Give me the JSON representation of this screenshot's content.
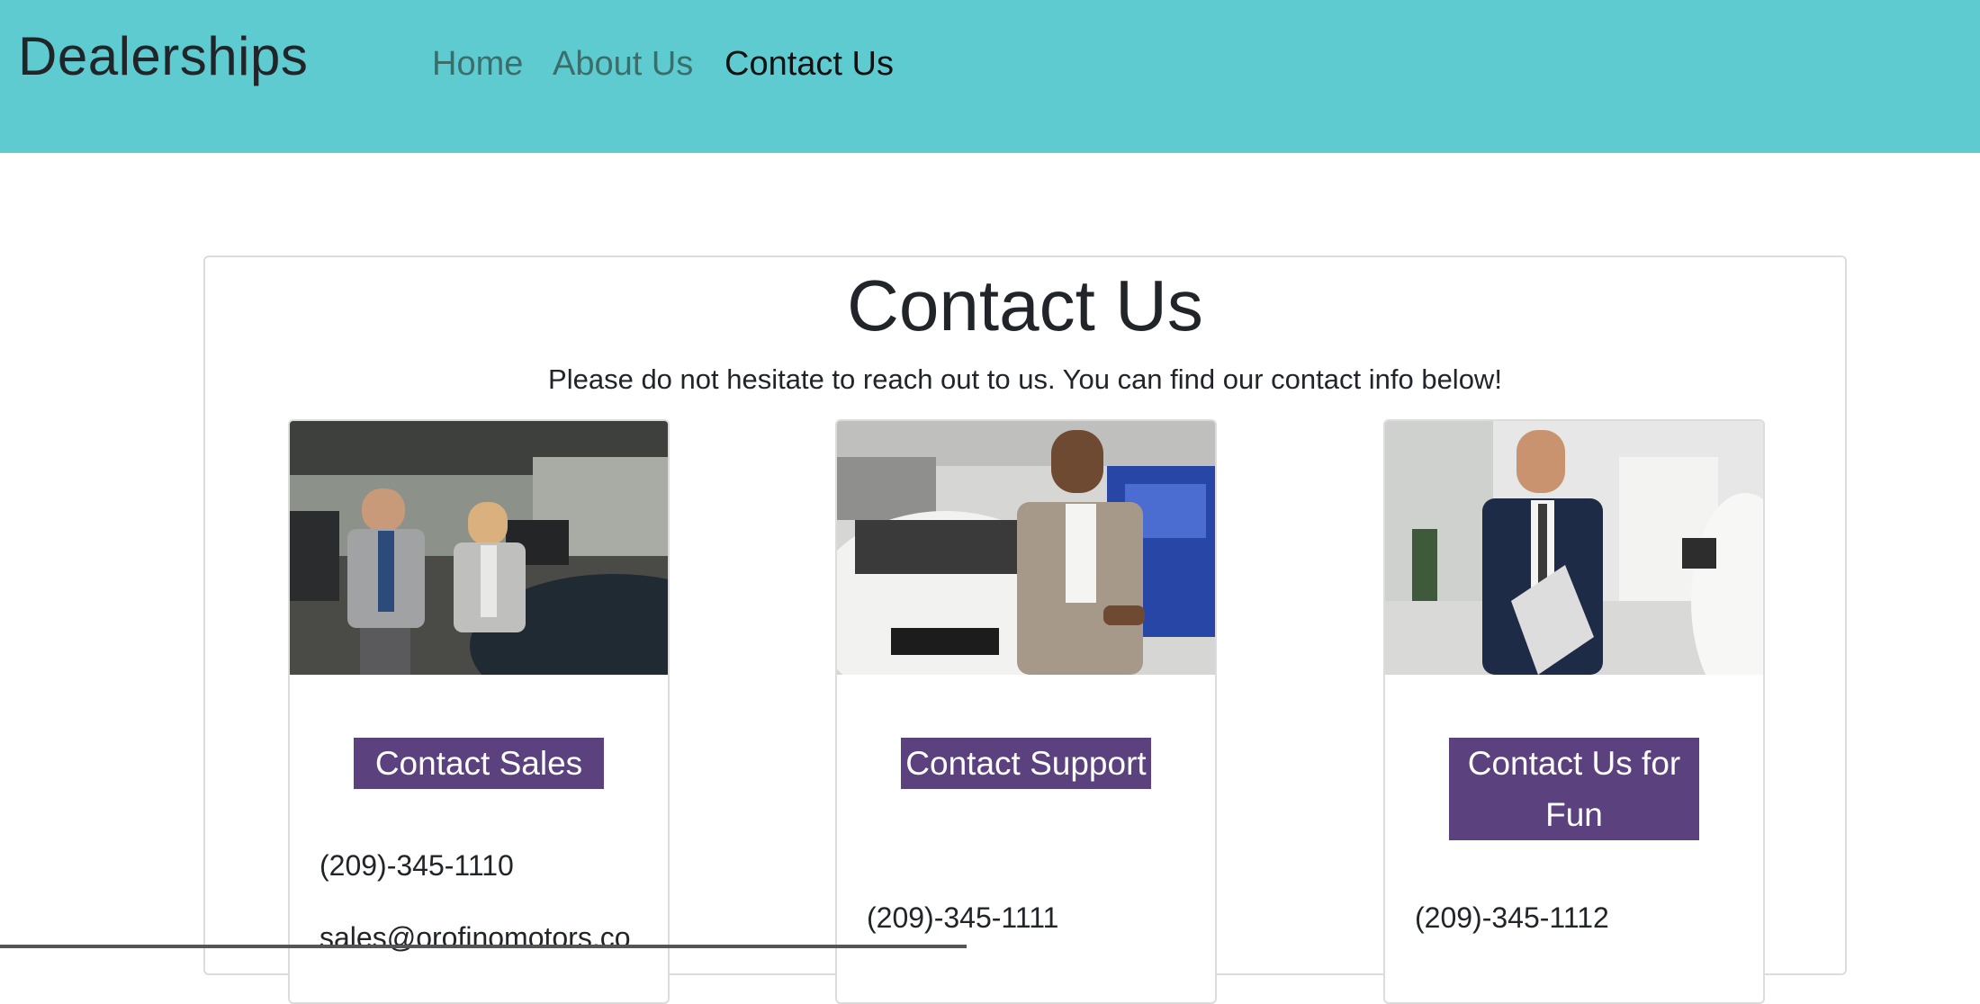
{
  "navbar": {
    "brand": "Dealerships",
    "links": [
      {
        "label": "Home"
      },
      {
        "label": "About Us"
      },
      {
        "label": "Contact Us"
      }
    ],
    "background": "#5ecbd0"
  },
  "main": {
    "title": "Contact Us",
    "subtitle": "Please do not hesitate to reach out to us. You can find our contact info below!",
    "cards": [
      {
        "image": "sales-team-photo",
        "button_label": "Contact Sales",
        "phone": "(209)-345-1110",
        "email": "sales@orofinomotors.co"
      },
      {
        "image": "support-agent-photo",
        "button_label": "Contact Support",
        "phone": "(209)-345-1111",
        "email": ""
      },
      {
        "image": "fun-contact-photo",
        "button_label": "Contact Us for Fun",
        "phone": "(209)-345-1112",
        "email": ""
      }
    ],
    "button_color": "#5c417f"
  }
}
